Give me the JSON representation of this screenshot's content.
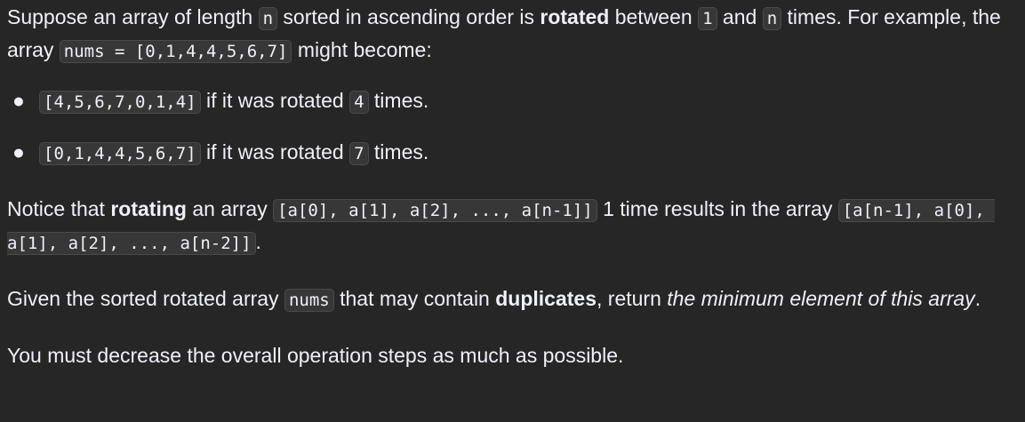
{
  "problem": {
    "p1": {
      "t1": "Suppose an array of length ",
      "c1": "n",
      "t2": " sorted in ascending order is ",
      "b1": "rotated",
      "t3": " between ",
      "c2": "1",
      "t4": " and ",
      "c3": "n",
      "t5": " times. For example, the array ",
      "c4": "nums = [0,1,4,4,5,6,7]",
      "t6": " might become:"
    },
    "bullets": [
      {
        "code": "[4,5,6,7,0,1,4]",
        "t1": " if it was rotated ",
        "num": "4",
        "t2": " times."
      },
      {
        "code": "[0,1,4,4,5,6,7]",
        "t1": " if it was rotated ",
        "num": "7",
        "t2": " times."
      }
    ],
    "p2": {
      "t1": "Notice that ",
      "b1": "rotating",
      "t2": " an array ",
      "c1": "[a[0], a[1], a[2], ..., a[n-1]]",
      "t3": " 1 time results in the array ",
      "c2": "[a[n-1], a[0], a[1], a[2], ..., a[n-2]]",
      "t4": "."
    },
    "p3": {
      "t1": "Given the sorted rotated array ",
      "c1": "nums",
      "t2": " that may contain ",
      "b1": "duplicates",
      "t3": ", return ",
      "i1": "the minimum element of this array",
      "t4": "."
    },
    "p4": {
      "t1": "You must decrease the overall operation steps as much as possible."
    }
  }
}
